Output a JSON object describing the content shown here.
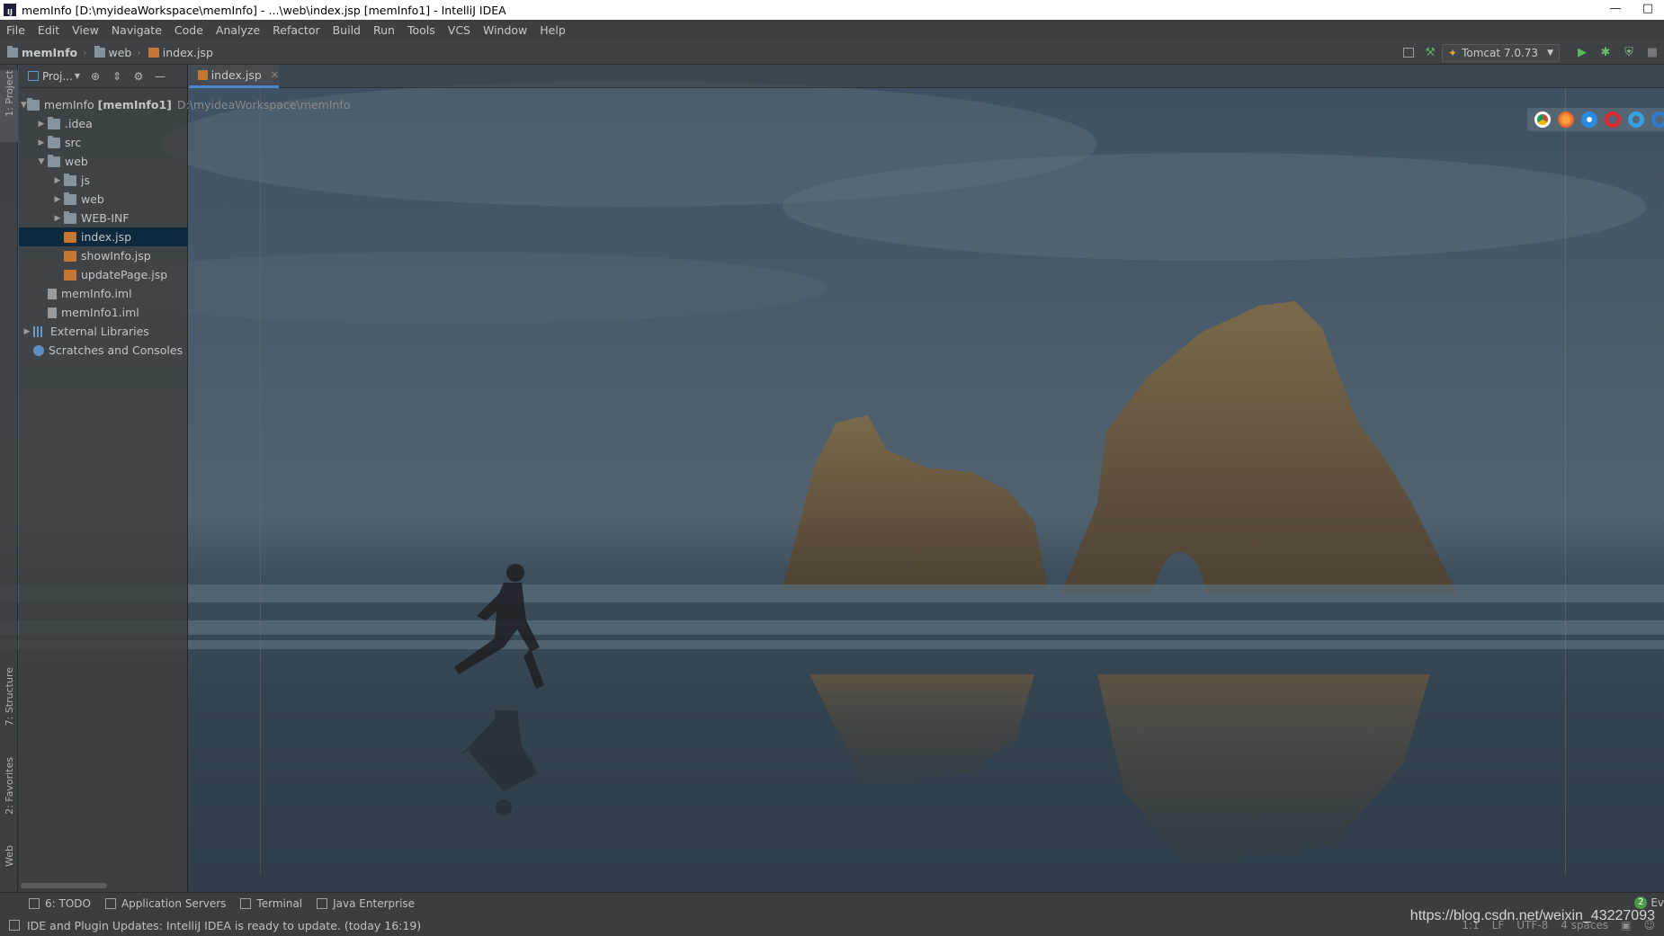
{
  "window": {
    "title": "memInfo [D:\\myideaWorkspace\\memInfo] - ...\\web\\index.jsp [memInfo1] - IntelliJ IDEA",
    "minimize": "—",
    "maximize": "□"
  },
  "menu": [
    "File",
    "Edit",
    "View",
    "Navigate",
    "Code",
    "Analyze",
    "Refactor",
    "Build",
    "Run",
    "Tools",
    "VCS",
    "Window",
    "Help"
  ],
  "breadcrumb": [
    "memInfo",
    "web",
    "index.jsp"
  ],
  "run_config": {
    "label": "Tomcat 7.0.73"
  },
  "side_tabs": {
    "project": "1: Project",
    "structure": "7: Structure",
    "favorites": "2: Favorites",
    "web": "Web"
  },
  "project_panel": {
    "title": "Proj...",
    "tree": [
      {
        "label": "memInfo",
        "bold": "[memInfo1]",
        "suffix": "D:\\myideaWorkspace\\memInfo",
        "type": "module"
      },
      {
        "label": ".idea",
        "type": "folder"
      },
      {
        "label": "src",
        "type": "folder"
      },
      {
        "label": "web",
        "type": "folder"
      },
      {
        "label": "js",
        "type": "folder"
      },
      {
        "label": "web",
        "type": "folder"
      },
      {
        "label": "WEB-INF",
        "type": "folder"
      },
      {
        "label": "index.jsp",
        "type": "jsp"
      },
      {
        "label": "showInfo.jsp",
        "type": "jsp"
      },
      {
        "label": "updatePage.jsp",
        "type": "jsp"
      },
      {
        "label": "memInfo.iml",
        "type": "iml"
      },
      {
        "label": "memInfo1.iml",
        "type": "iml"
      },
      {
        "label": "External Libraries",
        "type": "lib"
      },
      {
        "label": "Scratches and Consoles",
        "type": "scratch"
      }
    ]
  },
  "editor": {
    "tab": "index.jsp"
  },
  "tool_windows": [
    "6: TODO",
    "Application Servers",
    "Terminal",
    "Java Enterprise"
  ],
  "event_log": {
    "count": "2",
    "label": "Ev"
  },
  "status": {
    "message": "IDE and Plugin Updates: IntelliJ IDEA is ready to update. (today 16:19)",
    "position": "1:1",
    "line_sep": "LF",
    "encoding": "UTF-8",
    "indent": "4 spaces"
  },
  "watermark": "https://blog.csdn.net/weixin_43227093",
  "colors": {
    "accent": "#4a88c7",
    "selection": "#0d293e"
  }
}
